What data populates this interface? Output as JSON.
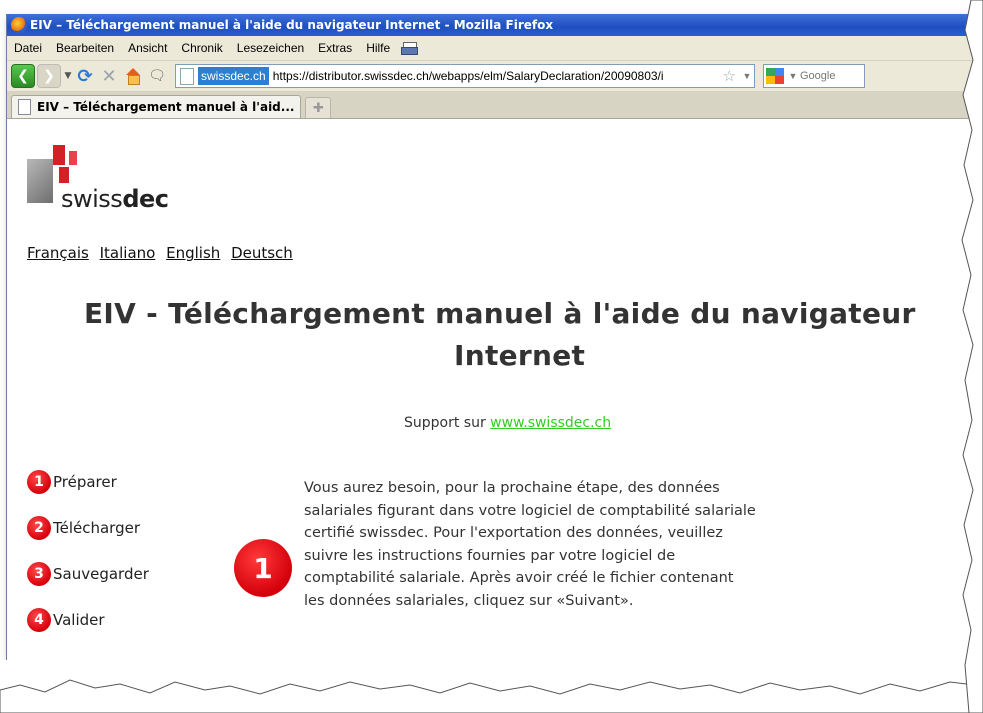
{
  "window": {
    "title": "EIV – Téléchargement manuel à l'aide du navigateur Internet - Mozilla Firefox"
  },
  "menu": [
    "Datei",
    "Bearbeiten",
    "Ansicht",
    "Chronik",
    "Lesezeichen",
    "Extras",
    "Hilfe"
  ],
  "nav": {
    "identity": "swissdec.ch",
    "url": "https://distributor.swissdec.ch/webapps/elm/SalaryDeclaration/20090803/i",
    "search_placeholder": "Google"
  },
  "tab": {
    "label": "EIV – Téléchargement manuel à l'aid..."
  },
  "page": {
    "logo_text_light": "swiss",
    "logo_text_bold": "dec",
    "languages": [
      "Français",
      "Italiano",
      "English",
      "Deutsch"
    ],
    "heading_line1": "EIV - Téléchargement manuel à l'aide du navigateur",
    "heading_line2": "Internet",
    "support_prefix": "Support sur ",
    "support_link": "www.swissdec.ch",
    "steps": [
      {
        "num": "1",
        "label": "Préparer"
      },
      {
        "num": "2",
        "label": "Télécharger"
      },
      {
        "num": "3",
        "label": "Sauvegarder"
      },
      {
        "num": "4",
        "label": "Valider"
      }
    ],
    "current_step": "1",
    "paragraph_lines": [
      "Vous aurez besoin, pour la prochaine étape, des données",
      "salariales figurant dans votre logiciel de comptabilité salariale",
      "certifié swissdec. Pour l'exportation des données, veuillez",
      "suivre les instructions fournies par votre logiciel de",
      "comptabilité salariale. Après avoir créé le fichier contenant",
      "les données salariales, cliquez sur «Suivant»."
    ]
  }
}
